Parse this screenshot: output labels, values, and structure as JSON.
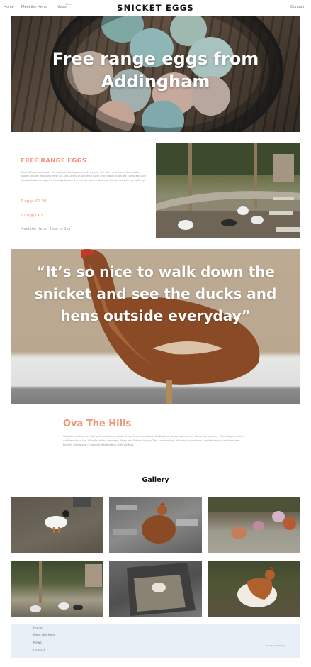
{
  "nav": {
    "home": "Home",
    "meet_the_hens": "Meet the Hens",
    "news": "News",
    "news_badge": "Soon",
    "contact": "Contact",
    "brand": "SNICKET EGGS"
  },
  "hero": {
    "heading": "Free range eggs from Addingham"
  },
  "free_range": {
    "title": "FREE RANGE EGGS",
    "text": "Snicket Eggs is a family of poultry in Addingham and beyond. Our hens and ducks live on the village snicket, enjoying fresh air and plenty of space to roam and forage. Eggs are collected daily and available through an honesty box on the snicket path — look out for the hens as you walk by.",
    "price_6": "6 eggs £1.50",
    "price_12": "12 eggs £3",
    "link_meet": "Meet the Hens",
    "link_buy": "How to Buy"
  },
  "quote": {
    "text": "“It’s so nice to walk down the snicket and see the ducks and hens outside everyday”"
  },
  "ova": {
    "title": "Ova The Hills",
    "text": "Situated on the river Wharfe and in the folds of the Yorkshire Dales, Addingham is surrounded by stunning scenery. The village nestles on the side of the Wharfe valley between Ilkley and Bolton Abbey. The surrounding hills and moorlands provide some considerable beauty and make it popular destination with visitors."
  },
  "gallery": {
    "title": "Gallery"
  },
  "footer": {
    "home": "Home",
    "meet_the_hens": "Meet the Hens",
    "news": "News",
    "contact": "Contact",
    "credit": "Site by Snicket Eggs"
  },
  "colors": {
    "accent": "#f2967a",
    "footer_bg": "#e8eff6"
  }
}
